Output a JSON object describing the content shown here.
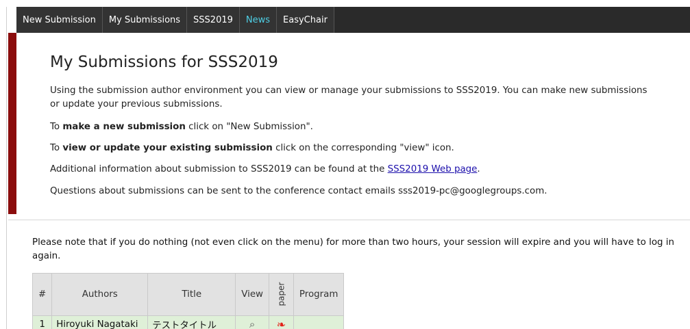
{
  "menu": {
    "items": [
      {
        "label": "New Submission"
      },
      {
        "label": "My Submissions"
      },
      {
        "label": "SSS2019"
      },
      {
        "label": "News"
      },
      {
        "label": "EasyChair"
      }
    ],
    "active": "News"
  },
  "page_title": "My Submissions for SSS2019",
  "info": {
    "p1_line1": "Using the submission author environment you can view or manage your submissions to SSS2019. You can make new submissions",
    "p1_line2": "or update your previous submissions.",
    "p2_prefix": "To ",
    "p2_bold": "make a new submission",
    "p2_suffix": " click on \"New Submission\".",
    "p3_prefix": "To ",
    "p3_bold": "view or update your existing submission",
    "p3_suffix": " click on the corresponding \"view\" icon.",
    "p4_prefix": "Additional information about submission to SSS2019 can be found at the ",
    "p4_link": "SSS2019 Web page",
    "p4_suffix": ".",
    "p5": "Questions about submissions can be sent to the conference contact emails sss2019-pc@googlegroups.com."
  },
  "note": "Please note that if you do nothing (not even click on the menu) for more than two hours, your session will expire and you will have to log in again.",
  "table": {
    "headers": {
      "num": "#",
      "authors": "Authors",
      "title": "Title",
      "view": "View",
      "paper": "paper",
      "program": "Program"
    },
    "rows": [
      {
        "num": "1",
        "authors": "Hiroyuki Nagataki",
        "title": "テストタイトル",
        "program": ""
      }
    ]
  },
  "colors": {
    "menubar": "#333333",
    "menu_active": "#4fd0e6",
    "info_accent": "#8b0d0d",
    "row_bg": "#dff0d8",
    "link": "#1a0dab"
  },
  "icons": {
    "view": "magnifier-icon",
    "paper": "pdf-icon"
  }
}
